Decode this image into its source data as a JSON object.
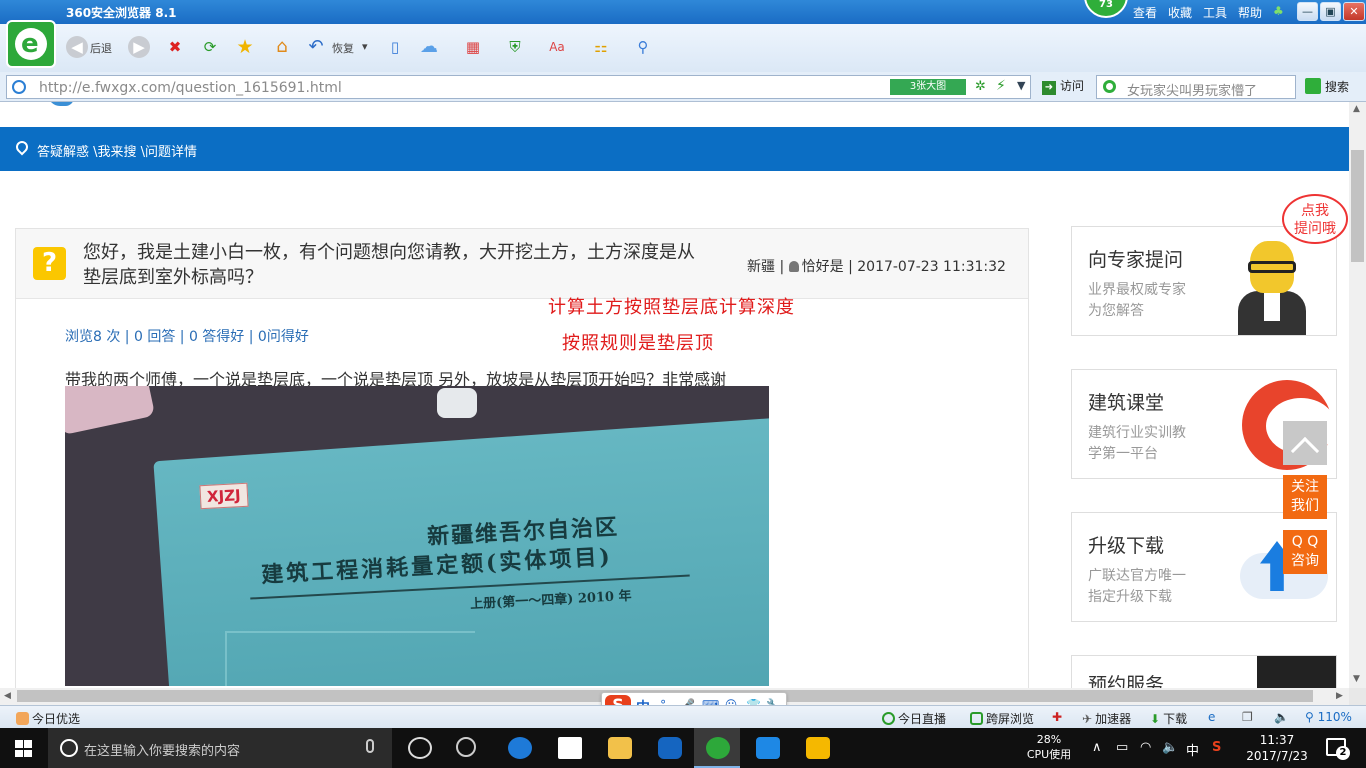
{
  "browser": {
    "title": "360安全浏览器 8.1",
    "score": "73",
    "menu": [
      "查看",
      "收藏",
      "工具",
      "帮助"
    ],
    "toolbar": {
      "back_label": "后退",
      "restore_label": "恢复"
    },
    "address": {
      "url": "http://e.fwxgx.com/question_1615691.html",
      "bigpic_label": "3张大图"
    },
    "visit_label": "访问",
    "search": {
      "placeholder": "女玩家尖叫男玩家懵了",
      "button_label": "搜索"
    }
  },
  "page": {
    "breadcrumb": "答疑解惑 \\我来搜 \\问题详情",
    "question": {
      "icon": "?",
      "title": "您好，我是土建小白一枚，有个问题想向您请教，大开挖土方，土方深度是从垫层底到室外标高吗？",
      "region": "新疆",
      "author": "恰好是",
      "datetime": "2017-07-23 11:31:32",
      "stats": "浏览8 次 | 0 回答 | 0 答得好 | 0问得好",
      "body": "带我的两个师傅，一个说是垫层底，一个说是垫层顶   另外，放坡是从垫层顶开始吗？非常感谢",
      "photo": {
        "stamp": "XJZJ",
        "book_title_1": "新疆维吾尔自治区",
        "book_title_2": "建筑工程消耗量定额(实体项目)",
        "book_title_3": "上册(第一～四章)   2010 年",
        "note_line1": "计算土方按照垫层底计算深度",
        "note_line2": "按照规则是垫层顶"
      }
    },
    "sidebar": {
      "bubble": [
        "点我",
        "提问哦"
      ],
      "expert": {
        "title": "向专家提问",
        "line1": "业界最权威专家",
        "line2": "为您解答"
      },
      "course": {
        "title": "建筑课堂",
        "line1": "建筑行业实训教",
        "line2": "学第一平台"
      },
      "upgrade": {
        "title": "升级下载",
        "line1": "广联达官方唯一",
        "line2": "指定升级下载"
      },
      "booking": {
        "title": "预约服务"
      }
    },
    "floating": {
      "follow": [
        "关注",
        "我们"
      ],
      "qq": [
        "Q Q",
        "咨询"
      ]
    }
  },
  "ime": {
    "mode": "中"
  },
  "statusbar": {
    "left": "今日优选",
    "items": [
      "今日直播",
      "跨屏浏览",
      "加速器",
      "下载"
    ],
    "zoom": "110%"
  },
  "taskbar": {
    "search_placeholder": "在这里输入你要搜索的内容",
    "cpu_percent": "28%",
    "cpu_label": "CPU使用",
    "ime_lang": "中",
    "time": "11:37",
    "date": "2017/7/23",
    "notifications": "2"
  }
}
